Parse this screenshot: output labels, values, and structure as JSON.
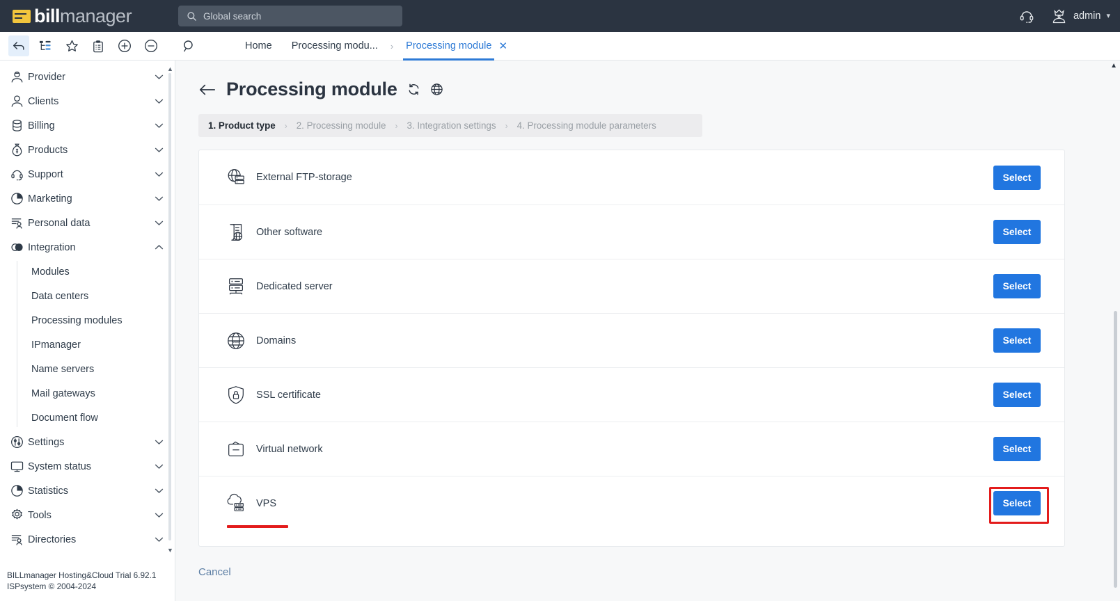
{
  "header": {
    "logo_text_bold": "bill",
    "logo_text_light": "manager",
    "search_placeholder": "Global search",
    "support_icon": "headset-icon",
    "user_name": "admin",
    "user_chevron": "⌄"
  },
  "toolbar": {
    "icons": [
      {
        "name": "back-arrow-icon",
        "active": true
      },
      {
        "name": "tree-hierarchy-icon",
        "active": false
      },
      {
        "name": "star-icon",
        "active": false
      },
      {
        "name": "clipboard-icon",
        "active": false
      },
      {
        "name": "plus-circle-icon",
        "active": false
      },
      {
        "name": "minus-circle-icon",
        "active": false
      },
      {
        "name": "search-icon",
        "active": false
      }
    ]
  },
  "tabs": [
    {
      "label": "Home",
      "active": false,
      "closable": false
    },
    {
      "label": "Processing modu...",
      "active": false,
      "closable": false
    },
    {
      "label": "›",
      "separator": true
    },
    {
      "label": "Processing module",
      "active": true,
      "closable": true,
      "close_glyph": "✕"
    }
  ],
  "sidebar": {
    "items": [
      {
        "label": "Provider",
        "icon": "provider-icon",
        "chevron": "down"
      },
      {
        "label": "Clients",
        "icon": "clients-icon",
        "chevron": "down"
      },
      {
        "label": "Billing",
        "icon": "billing-icon",
        "chevron": "down"
      },
      {
        "label": "Products",
        "icon": "products-icon",
        "chevron": "down"
      },
      {
        "label": "Support",
        "icon": "support-icon",
        "chevron": "down"
      },
      {
        "label": "Marketing",
        "icon": "marketing-icon",
        "chevron": "down"
      },
      {
        "label": "Personal data",
        "icon": "personal-data-icon",
        "chevron": "down"
      },
      {
        "label": "Integration",
        "icon": "integration-icon",
        "chevron": "up"
      }
    ],
    "integration_subitems": [
      {
        "label": "Modules"
      },
      {
        "label": "Data centers"
      },
      {
        "label": "Processing modules"
      },
      {
        "label": "IPmanager"
      },
      {
        "label": "Name servers"
      },
      {
        "label": "Mail gateways"
      },
      {
        "label": "Document flow"
      }
    ],
    "items_after": [
      {
        "label": "Settings",
        "icon": "settings-icon",
        "chevron": "down"
      },
      {
        "label": "System status",
        "icon": "monitor-icon",
        "chevron": "down"
      },
      {
        "label": "Statistics",
        "icon": "statistics-icon",
        "chevron": "down"
      },
      {
        "label": "Tools",
        "icon": "gear-icon",
        "chevron": "down"
      },
      {
        "label": "Directories",
        "icon": "directories-icon",
        "chevron": "down"
      }
    ],
    "footer_line1": "BILLmanager Hosting&Cloud Trial 6.92.1",
    "footer_line2": "ISPsystem © 2004-2024"
  },
  "page": {
    "title": "Processing module",
    "back_icon": "back-arrow-icon",
    "refresh_icon": "refresh-icon",
    "globe_icon": "globe-icon",
    "cancel_label": "Cancel"
  },
  "wizard": {
    "steps": [
      {
        "label": "1. Product type",
        "current": true
      },
      {
        "label": "2. Processing module",
        "current": false
      },
      {
        "label": "3. Integration settings",
        "current": false
      },
      {
        "label": "4. Processing module parameters",
        "current": false
      }
    ],
    "separator": "›"
  },
  "product_list": {
    "select_label": "Select",
    "rows": [
      {
        "label": "External FTP-storage",
        "icon": "globe-storage-icon",
        "annotated": false
      },
      {
        "label": "Other software",
        "icon": "software-globe-icon",
        "annotated": false
      },
      {
        "label": "Dedicated server",
        "icon": "server-rack-icon",
        "annotated": false
      },
      {
        "label": "Domains",
        "icon": "www-globe-icon",
        "annotated": false
      },
      {
        "label": "SSL certificate",
        "icon": "shield-lock-icon",
        "annotated": false
      },
      {
        "label": "Virtual network",
        "icon": "network-box-icon",
        "annotated": false
      },
      {
        "label": "VPS",
        "icon": "cloud-server-icon",
        "annotated": true
      }
    ]
  },
  "colors": {
    "header_bg": "#2b3441",
    "accent_blue": "#2176e0",
    "tab_active": "#2d7ad6",
    "annotation_red": "#e31c1c",
    "logo_yellow": "#f2c53d",
    "page_bg": "#f7f8f9"
  },
  "annotations": {
    "red_box_target": "Select",
    "red_underline_target": "VPS"
  }
}
